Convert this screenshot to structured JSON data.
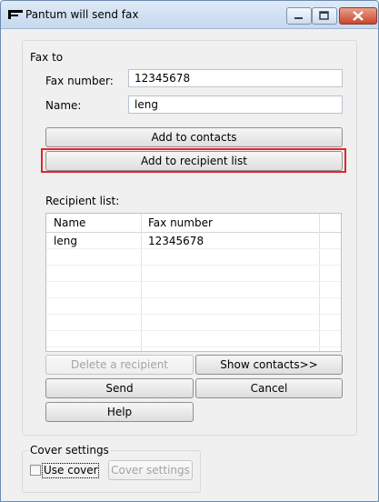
{
  "window": {
    "title": "Pantum will send fax"
  },
  "fax_to": {
    "legend": "Fax to",
    "fax_number_label": "Fax number:",
    "fax_number_value": "12345678",
    "name_label": "Name:",
    "name_value": "leng",
    "add_to_contacts": "Add to contacts",
    "add_to_recipient_list": "Add to recipient list"
  },
  "recipient_list": {
    "label": "Recipient list:",
    "columns": [
      "Name",
      "Fax number"
    ],
    "rows": [
      {
        "name": "leng",
        "fax_number": "12345678"
      }
    ]
  },
  "buttons": {
    "delete_recipient": "Delete a recipient",
    "show_contacts": "Show contacts>>",
    "send": "Send",
    "cancel": "Cancel",
    "help": "Help"
  },
  "cover": {
    "legend": "Cover settings",
    "use_cover_label": "Use cover",
    "use_cover_checked": false,
    "cover_settings_button": "Cover settings"
  },
  "colors": {
    "highlight": "#e0262c",
    "titlebar": "#c6d9ef",
    "close_button": "#c7452c"
  }
}
